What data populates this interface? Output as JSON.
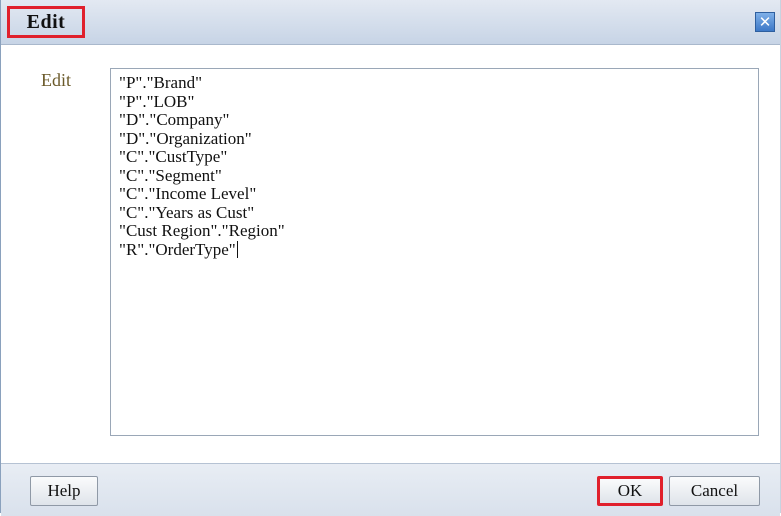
{
  "dialog": {
    "title": "Edit",
    "close_icon": "close-icon"
  },
  "form": {
    "label": "Edit",
    "lines": [
      "\"P\".\"Brand\"",
      "\"P\".\"LOB\"",
      "\"D\".\"Company\"",
      "\"D\".\"Organization\"",
      "\"C\".\"CustType\"",
      "\"C\".\"Segment\"",
      "\"C\".\"Income Level\"",
      "\"C\".\"Years as Cust\"",
      "\"Cust Region\".\"Region\"",
      "\"R\".\"OrderType\""
    ]
  },
  "footer": {
    "help_label": "Help",
    "ok_label": "OK",
    "cancel_label": "Cancel"
  },
  "colors": {
    "highlight": "#e0202c",
    "title_bar": "#c7d4e6",
    "label_text": "#6b5a2a"
  }
}
